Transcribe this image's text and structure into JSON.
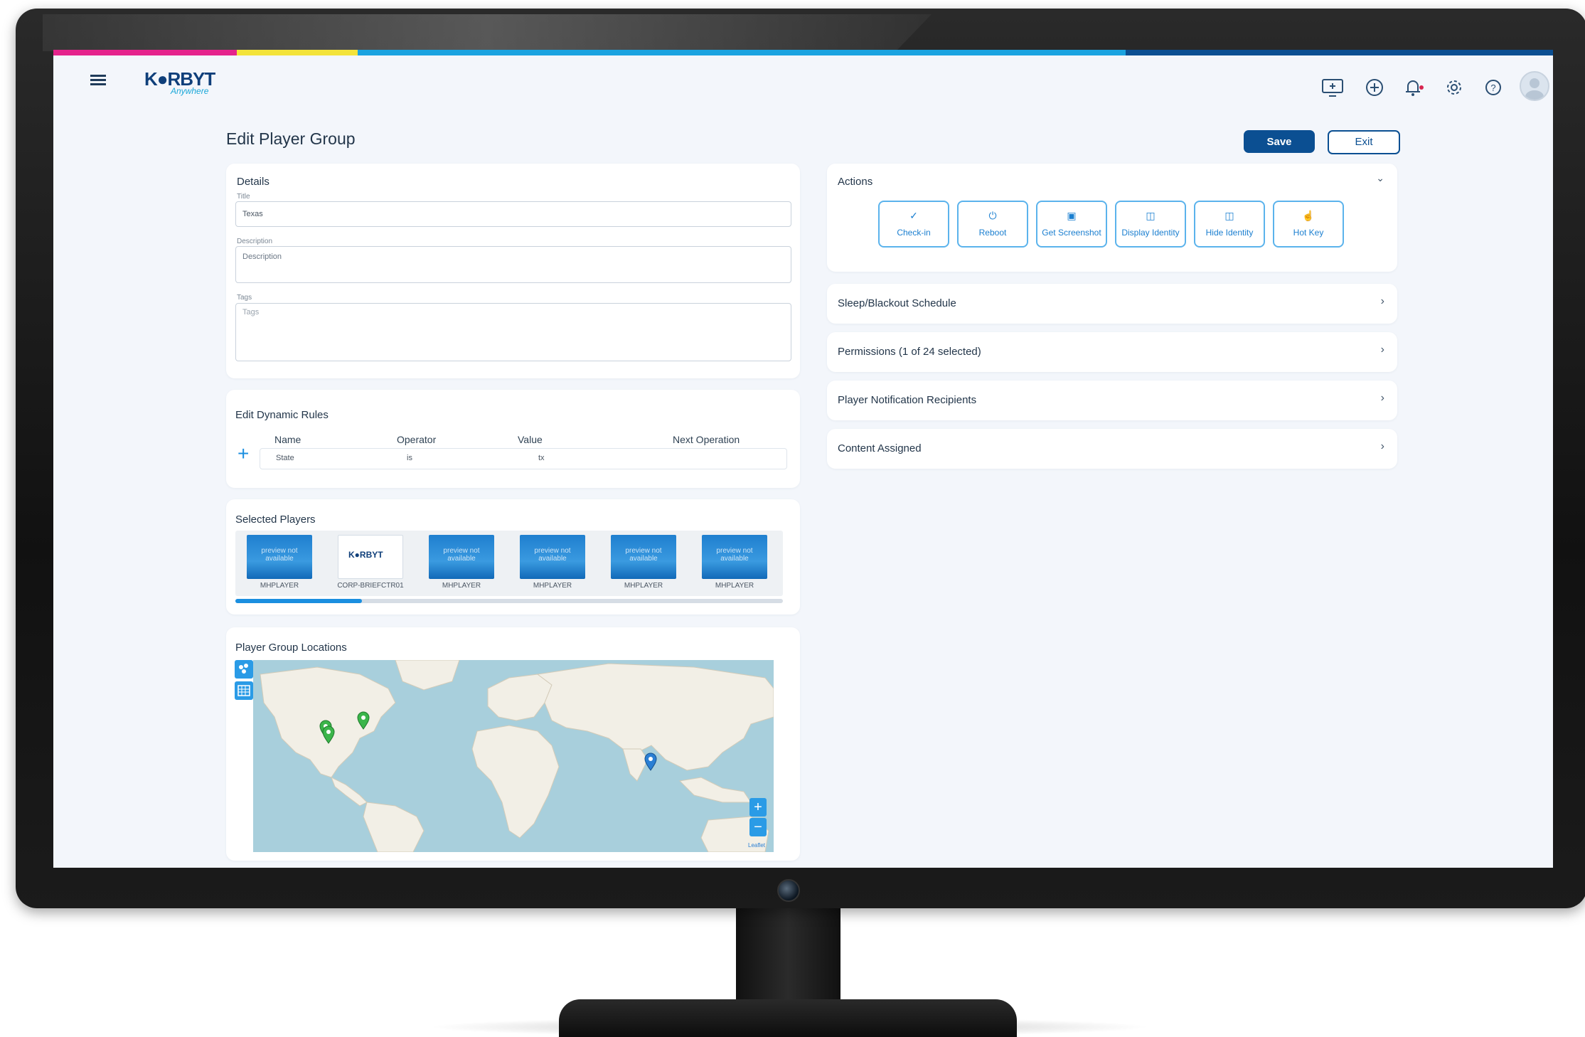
{
  "app": {
    "logo_text": "K●RBYT",
    "logo_sub": "Anywhere",
    "brand_colors": [
      "#e5238c",
      "#f3e33a",
      "#1aa3e0",
      "#0b4f92"
    ]
  },
  "toolbar": {
    "icons": [
      "screen-add-icon",
      "plus-circle-icon",
      "bell-icon",
      "gear-icon",
      "help-icon",
      "user-avatar"
    ]
  },
  "page": {
    "title": "Edit Player Group",
    "save_label": "Save",
    "exit_label": "Exit"
  },
  "details": {
    "heading": "Details",
    "title_label": "Title",
    "title_value": "Texas",
    "description_label": "Description",
    "description_placeholder": "Description",
    "tags_label": "Tags",
    "tags_placeholder": "Tags"
  },
  "rules": {
    "heading": "Edit Dynamic Rules",
    "columns": [
      "Name",
      "Operator",
      "Value",
      "Next Operation"
    ],
    "row": {
      "name": "State",
      "operator": "is",
      "value": "tx"
    }
  },
  "selected_players": {
    "heading": "Selected Players",
    "preview_text": "preview not available",
    "players": [
      {
        "name": "MHPLAYER",
        "thumb": "blue"
      },
      {
        "name": "CORP-BRIEFCTR01",
        "thumb": "logo",
        "logo_text": "K●RBYT"
      },
      {
        "name": "MHPLAYER",
        "thumb": "blue"
      },
      {
        "name": "MHPLAYER",
        "thumb": "blue"
      },
      {
        "name": "MHPLAYER",
        "thumb": "blue"
      },
      {
        "name": "MHPLAYER",
        "thumb": "blue"
      }
    ]
  },
  "locations": {
    "heading": "Player Group Locations",
    "attribution": "Leaflet",
    "zoom_in": "+",
    "zoom_out": "−"
  },
  "actions": {
    "heading": "Actions",
    "buttons": [
      {
        "label": "Check-in",
        "icon": "check-icon",
        "glyph": "✓"
      },
      {
        "label": "Reboot",
        "icon": "power-icon",
        "glyph": "⏻"
      },
      {
        "label": "Get Screenshot",
        "icon": "screenshot-icon",
        "glyph": "▣"
      },
      {
        "label": "Display Identity",
        "icon": "display-identity-icon",
        "glyph": "◫"
      },
      {
        "label": "Hide Identity",
        "icon": "hide-identity-icon",
        "glyph": "◫"
      },
      {
        "label": "Hot Key",
        "icon": "hot-key-icon",
        "glyph": "☝"
      }
    ]
  },
  "accordions": [
    {
      "label": "Sleep/Blackout Schedule"
    },
    {
      "label": "Permissions (1 of 24 selected)"
    },
    {
      "label": "Player Notification Recipients"
    },
    {
      "label": "Content Assigned"
    }
  ]
}
